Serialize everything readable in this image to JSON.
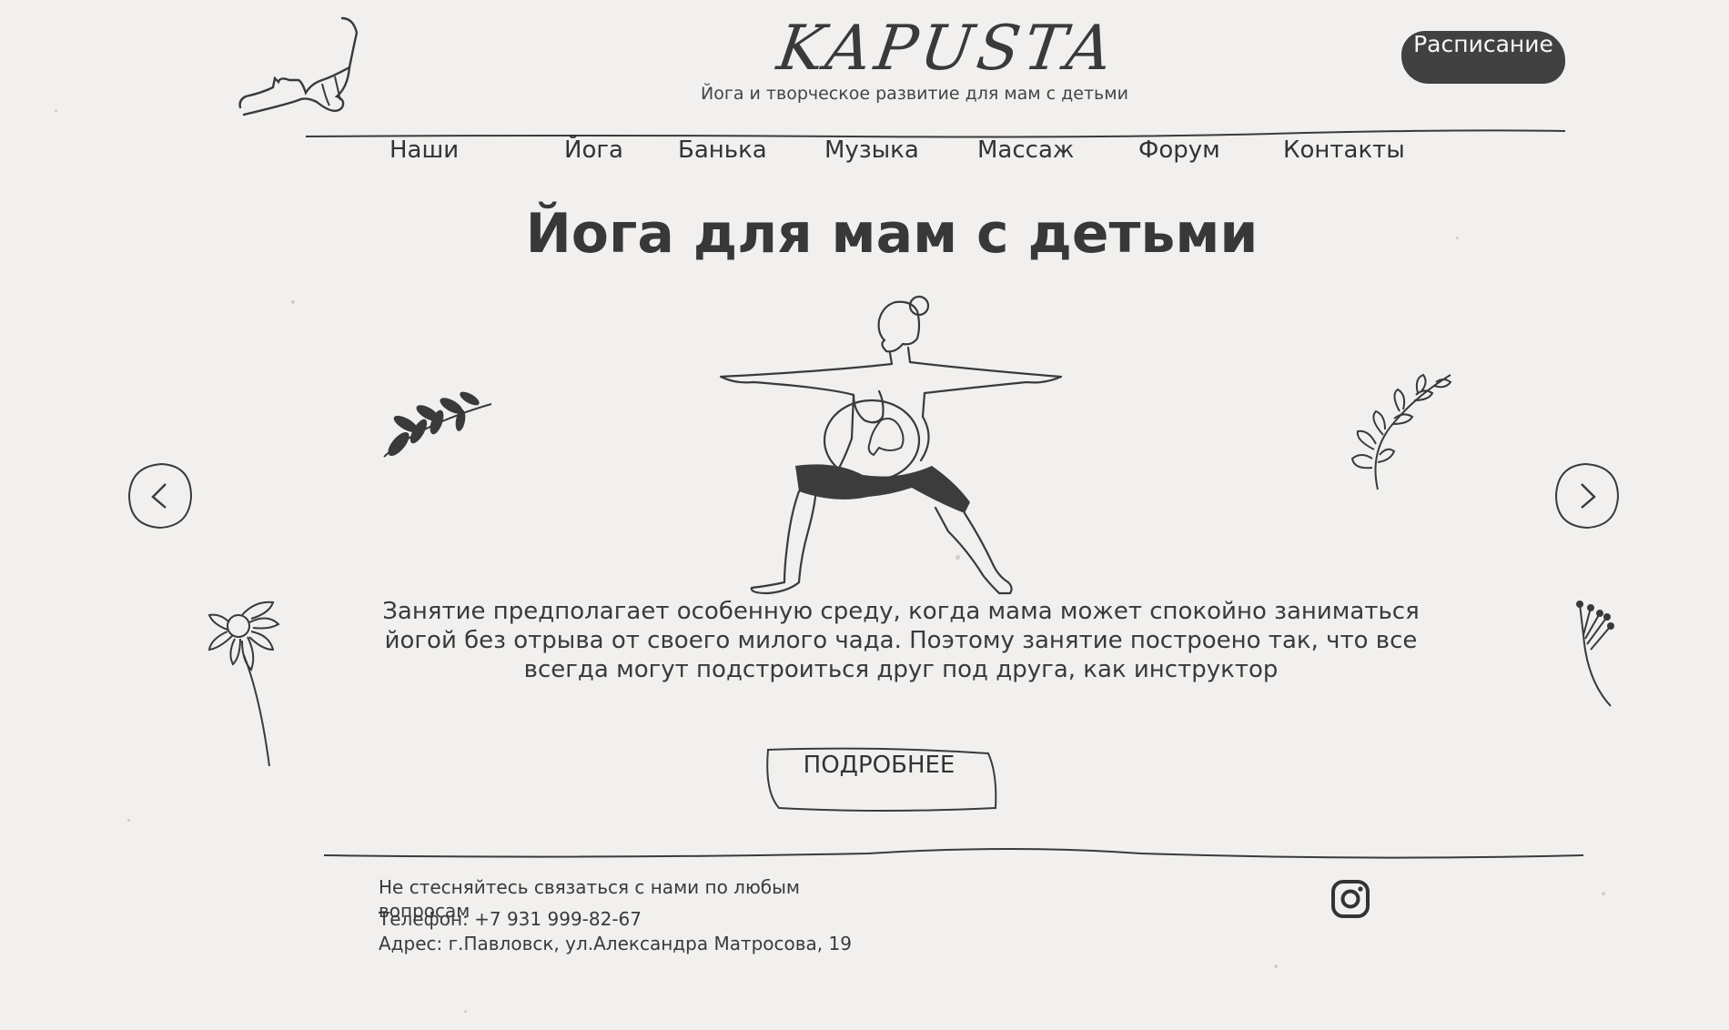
{
  "brand": {
    "logo": "KAPUSTA",
    "tagline": "Йога и творческое развитие для мам с детьми"
  },
  "header": {
    "schedule_label": "Расписание"
  },
  "nav": {
    "items": [
      {
        "label": "Наши"
      },
      {
        "label": "Йога"
      },
      {
        "label": "Банька"
      },
      {
        "label": "Музыка"
      },
      {
        "label": "Массаж"
      },
      {
        "label": "Форум"
      },
      {
        "label": "Контакты"
      }
    ]
  },
  "hero": {
    "title": "Йога для мам с детьми",
    "description": "Занятие предполагает особенную среду, когда мама может спокойно заниматься йогой без отрыва от своего милого чада. Поэтому занятие построено так, что все всегда могут подстроиться друг под друга, как инструктор",
    "more_label": "ПОДРОБНЕЕ"
  },
  "footer": {
    "contact_text": "Не стесняйтесь связаться с нами по любым вопросам",
    "phone": "Телефон: +7 931 999-82-67",
    "address": "Адрес: г.Павловск, ул.Александра Матросова, 19"
  },
  "icons": {
    "prev": "chevron-left-icon",
    "next": "chevron-right-icon",
    "social": "instagram-icon"
  },
  "colors": {
    "background": "#f1f0ee",
    "ink": "#3c3c3c",
    "button_dark": "#414141",
    "button_text": "#f7f7f5"
  }
}
